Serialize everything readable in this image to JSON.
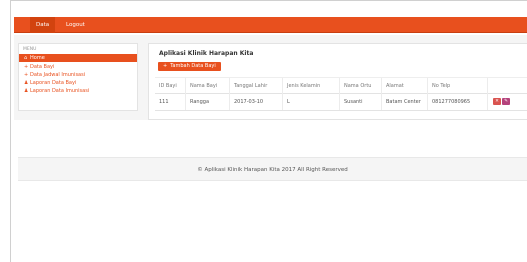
{
  "navbar": {
    "items": [
      {
        "label": "Data"
      },
      {
        "label": "Logout"
      }
    ],
    "color": "#e8501e"
  },
  "sidebar": {
    "title": "MENU",
    "items": [
      {
        "icon": "home-icon",
        "glyph": "⌂",
        "label": "Home",
        "active": true
      },
      {
        "icon": "plus-icon",
        "glyph": "+",
        "label": "Data Bayi",
        "active": false
      },
      {
        "icon": "plus-icon",
        "glyph": "+",
        "label": "Data Jadwal Imunisasi",
        "active": false
      },
      {
        "icon": "user-icon",
        "glyph": "♟",
        "label": "Laporan Data Bayi",
        "active": false
      },
      {
        "icon": "user-icon",
        "glyph": "♟",
        "label": "Laporan Data Imunisasi",
        "active": false
      }
    ]
  },
  "main": {
    "title": "Aplikasi Klinik Harapan Kita",
    "add_button": "Tambah Data Bayi",
    "table": {
      "headers": [
        "ID Bayi",
        "Nama Bayi",
        "Tanggal Lahir",
        "Jenis Kelamin",
        "Nama Ortu",
        "Alamat",
        "No Telp"
      ],
      "rows": [
        [
          "111",
          "Rangga",
          "2017-03-10",
          "L",
          "Susanti",
          "Batam Center",
          "081277080965"
        ]
      ]
    }
  },
  "footer": {
    "text": "© Aplikasi Klinik Harapan Kita 2017 All Right Reserved"
  }
}
